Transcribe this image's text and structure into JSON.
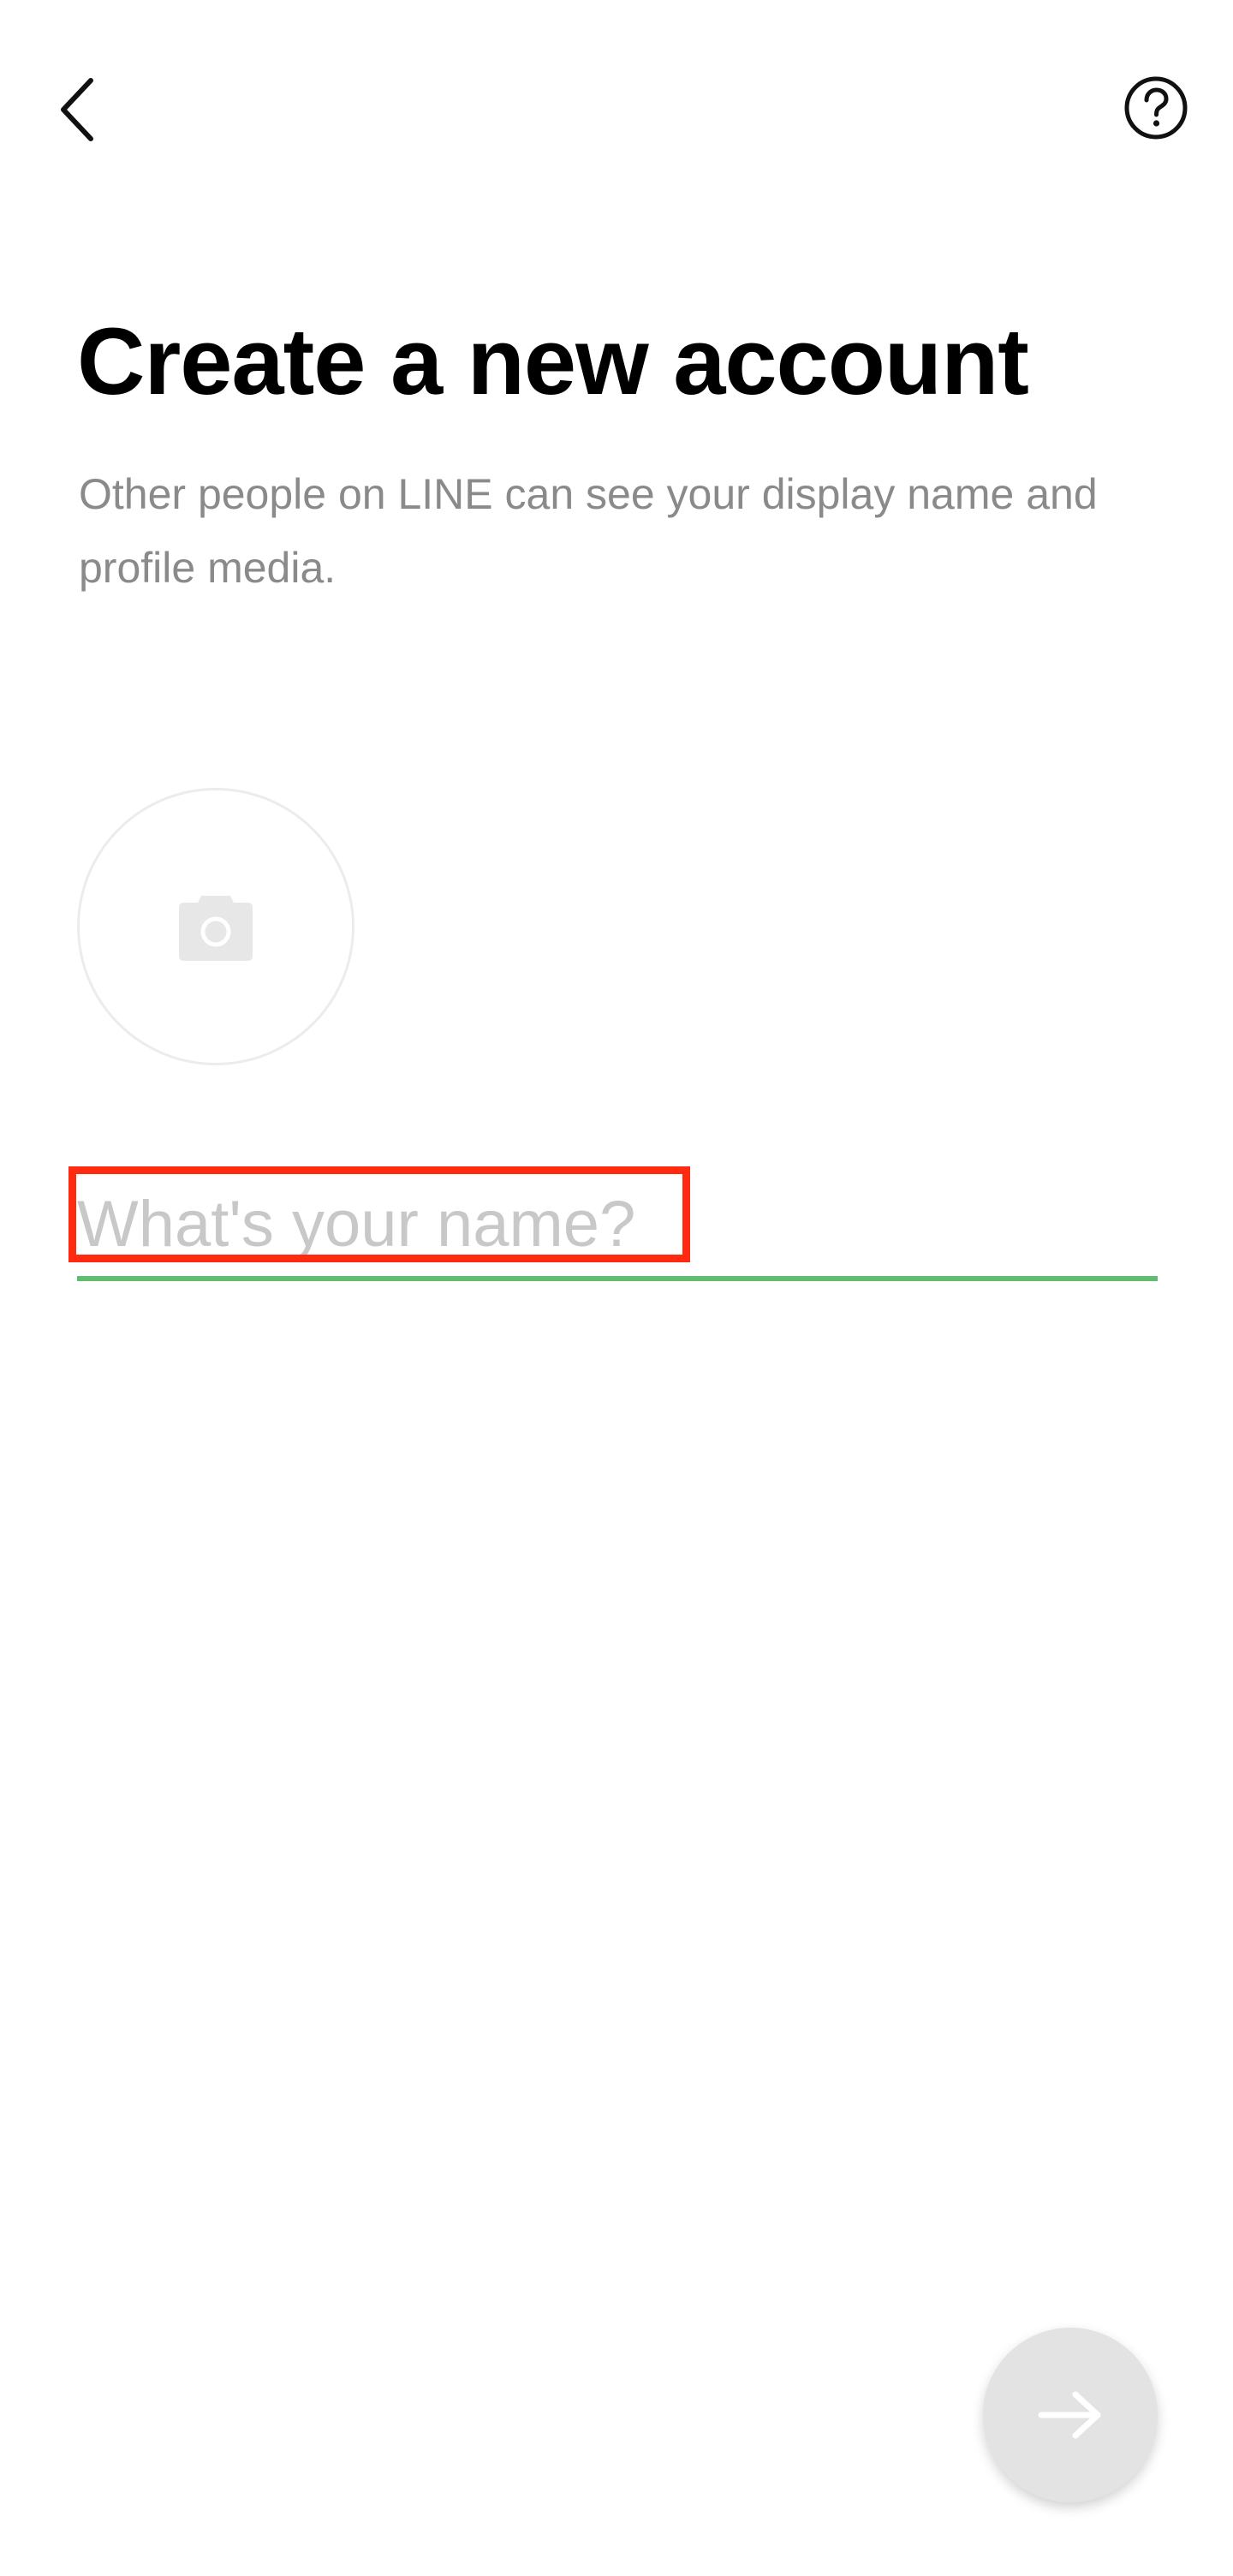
{
  "header": {
    "back_icon": "chevron-left-icon",
    "help_icon": "question-circle-icon"
  },
  "page": {
    "title": "Create a new account",
    "subtitle": "Other people on LINE can see your display name and profile media."
  },
  "profile": {
    "photo_icon": "camera-icon"
  },
  "name_field": {
    "placeholder": "What's your name?",
    "value": ""
  },
  "footer": {
    "next_icon": "arrow-right-icon"
  },
  "colors": {
    "accent_underline": "#5ebd6e",
    "highlight_box": "#ff2a10",
    "subtitle_text": "#8a8a8a",
    "placeholder_text": "#c8c8c8",
    "next_button_bg": "#e3e3e3"
  }
}
